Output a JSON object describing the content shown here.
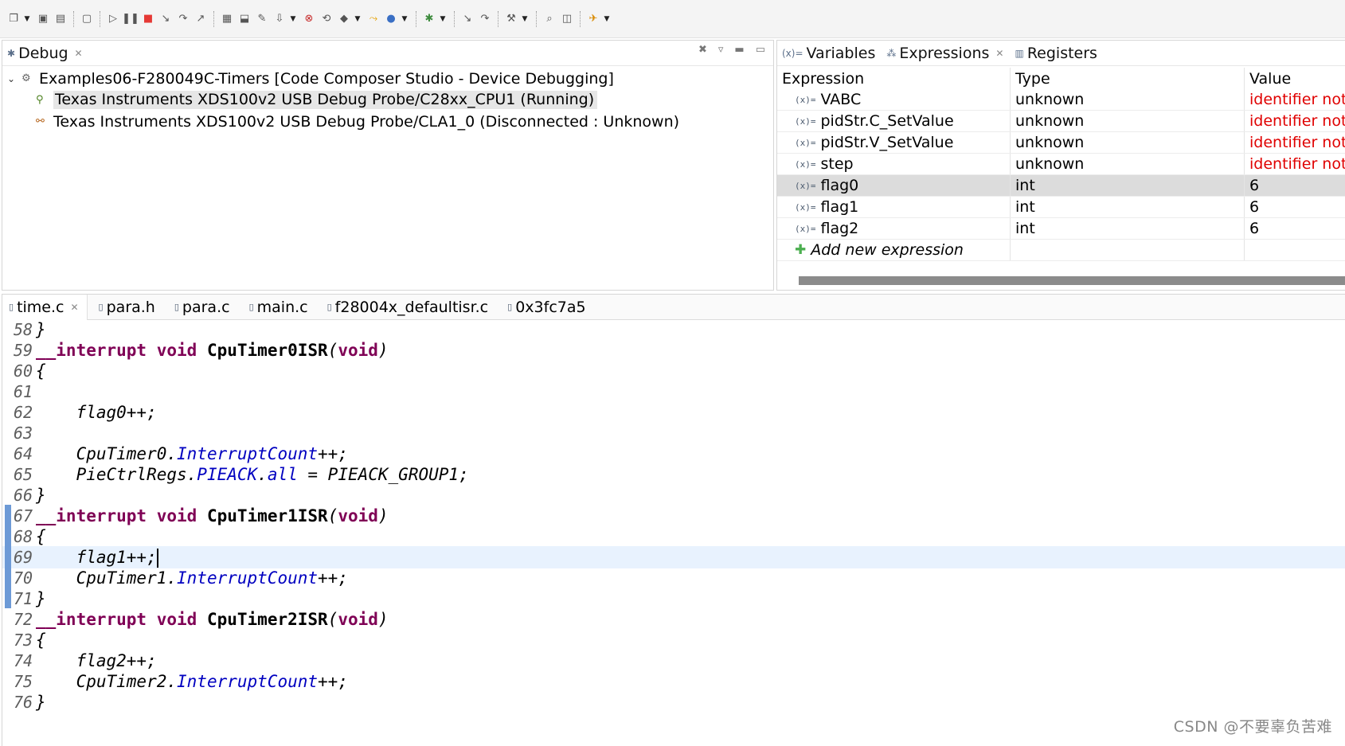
{
  "toolbar": {
    "buttons": [
      {
        "icon": "new-window-icon",
        "glyph": "❐",
        "dropdown": true
      },
      {
        "icon": "save-icon",
        "glyph": "▣"
      },
      {
        "icon": "save-all-icon",
        "glyph": "▤"
      },
      {
        "sep": true
      },
      {
        "icon": "debug-view-icon",
        "glyph": "▢"
      },
      {
        "sep": true
      },
      {
        "icon": "resume-icon",
        "glyph": "▷"
      },
      {
        "icon": "suspend-icon",
        "glyph": "❚❚"
      },
      {
        "icon": "terminate-icon",
        "glyph": "■",
        "color": "#e53935"
      },
      {
        "icon": "step-into-icon",
        "glyph": "↘"
      },
      {
        "icon": "step-over-icon",
        "glyph": "↷"
      },
      {
        "icon": "step-return-icon",
        "glyph": "↗"
      },
      {
        "sep": true
      },
      {
        "icon": "memory-grid-icon",
        "glyph": "▦"
      },
      {
        "icon": "connect-target-icon",
        "glyph": "⬓"
      },
      {
        "icon": "wrench-link-icon",
        "glyph": "✎"
      },
      {
        "icon": "load-program-icon",
        "glyph": "⇩",
        "dropdown": true
      },
      {
        "icon": "reset-cpu-icon",
        "glyph": "⊗",
        "color": "#c62828"
      },
      {
        "icon": "restart-icon",
        "glyph": "⟲"
      },
      {
        "icon": "breakpoint-icon",
        "glyph": "◆",
        "dropdown": true
      },
      {
        "icon": "run-to-line-icon",
        "glyph": "⤳",
        "color": "#e6a100"
      },
      {
        "icon": "debug-launch-icon",
        "glyph": "●",
        "color": "#3a6fc4",
        "dropdown": true
      },
      {
        "sep": true
      },
      {
        "icon": "debug-settings-icon",
        "glyph": "✱",
        "color": "#3d8b3d",
        "dropdown": true
      },
      {
        "sep": true
      },
      {
        "icon": "asm-step-icon",
        "glyph": "↘"
      },
      {
        "icon": "asm-step-over-icon",
        "glyph": "↷"
      },
      {
        "sep": true
      },
      {
        "icon": "build-hammer-icon",
        "glyph": "⚒",
        "dropdown": true
      },
      {
        "sep": true
      },
      {
        "icon": "search-icon",
        "glyph": "⌕"
      },
      {
        "icon": "open-view-icon",
        "glyph": "◫"
      },
      {
        "sep": true
      },
      {
        "icon": "launch-rocket-icon",
        "glyph": "✈",
        "color": "#d98a00",
        "dropdown": true
      }
    ]
  },
  "debug_view": {
    "tab_label": "Debug",
    "root": "Examples06-F280049C-Timers [Code Composer Studio - Device Debugging]",
    "children": [
      "Texas Instruments XDS100v2 USB Debug Probe/C28xx_CPU1 (Running)",
      "Texas Instruments XDS100v2 USB Debug Probe/CLA1_0 (Disconnected : Unknown)"
    ]
  },
  "expr_view": {
    "tabs": [
      "Variables",
      "Expressions",
      "Registers"
    ],
    "headers": [
      "Expression",
      "Type",
      "Value"
    ],
    "rows": [
      {
        "expr": "VABC",
        "type": "unknown",
        "value": "identifier not found: VABC",
        "error": true
      },
      {
        "expr": "pidStr.C_SetValue",
        "type": "unknown",
        "value": "identifier not found: pidStr",
        "error": true
      },
      {
        "expr": "pidStr.V_SetValue",
        "type": "unknown",
        "value": "identifier not found: pidStr",
        "error": true
      },
      {
        "expr": "step",
        "type": "unknown",
        "value": "identifier not found: step",
        "error": true
      },
      {
        "expr": "flag0",
        "type": "int",
        "value": "6",
        "error": false,
        "selected": true
      },
      {
        "expr": "flag1",
        "type": "int",
        "value": "6",
        "error": false
      },
      {
        "expr": "flag2",
        "type": "int",
        "value": "6",
        "error": false
      }
    ],
    "add_label": "Add new expression"
  },
  "editor": {
    "tabs": [
      "time.c",
      "para.h",
      "para.c",
      "main.c",
      "f28004x_defaultisr.c",
      "0x3fc7a5"
    ],
    "lines": [
      {
        "n": "58",
        "code": "}"
      },
      {
        "n": "59",
        "code": "__interrupt void CpuTimer0ISR(void)"
      },
      {
        "n": "60",
        "code": "{"
      },
      {
        "n": "61",
        "code": ""
      },
      {
        "n": "62",
        "code": "    flag0++;"
      },
      {
        "n": "63",
        "code": ""
      },
      {
        "n": "64",
        "code": "    CpuTimer0.InterruptCount++;"
      },
      {
        "n": "65",
        "code": "    PieCtrlRegs.PIEACK.all = PIEACK_GROUP1;"
      },
      {
        "n": "66",
        "code": "}"
      },
      {
        "n": "67",
        "code": "__interrupt void CpuTimer1ISR(void)"
      },
      {
        "n": "68",
        "code": "{"
      },
      {
        "n": "69",
        "code": "    flag1++;"
      },
      {
        "n": "70",
        "code": "    CpuTimer1.InterruptCount++;"
      },
      {
        "n": "71",
        "code": "}"
      },
      {
        "n": "72",
        "code": "__interrupt void CpuTimer2ISR(void)"
      },
      {
        "n": "73",
        "code": "{"
      },
      {
        "n": "74",
        "code": "    flag2++;"
      },
      {
        "n": "75",
        "code": "    CpuTimer2.InterruptCount++;"
      },
      {
        "n": "76",
        "code": "}"
      }
    ],
    "current_line": "69"
  },
  "watermark": "CSDN @不要辜负苦难",
  "colors": {
    "keyword": "#7f0055",
    "field": "#0000c0",
    "error": "#e00000",
    "current_line_bg": "#e8f2fe"
  }
}
